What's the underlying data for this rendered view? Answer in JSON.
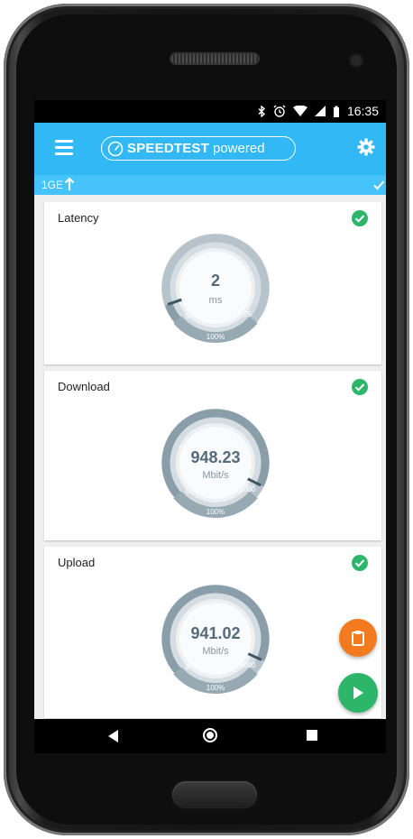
{
  "status_bar": {
    "time": "16:35",
    "icons": [
      "bluetooth-icon",
      "alarm-icon",
      "wifi-icon",
      "signal-icon",
      "battery-icon"
    ]
  },
  "app_bar": {
    "brand_main": "SPEEDTEST",
    "brand_sub": "powered",
    "menu_icon": "hamburger-menu-icon",
    "settings_icon": "gear-icon",
    "color": "#31b8f5"
  },
  "info_bar": {
    "label": "1GE",
    "arrow_icon": "arrow-up-icon",
    "check_icon": "checkmark-icon",
    "color": "#46c3fa"
  },
  "cards": [
    {
      "title": "Latency",
      "value": "2",
      "unit": "ms",
      "scale_min": "0",
      "scale_max": "25",
      "percent_label": "100%",
      "fraction": 0.08
    },
    {
      "title": "Download",
      "value": "948.23",
      "unit": "Mbit/s",
      "scale_min": "0",
      "scale_max": "1000",
      "percent_label": "100%",
      "fraction": 0.948
    },
    {
      "title": "Upload",
      "value": "941.02",
      "unit": "Mbit/s",
      "scale_min": "0",
      "scale_max": "1000",
      "percent_label": "100%",
      "fraction": 0.941
    }
  ],
  "fabs": {
    "clipboard_icon": "clipboard-icon",
    "clipboard_color": "#f47a1f",
    "play_icon": "play-icon",
    "play_color": "#2db669"
  },
  "nav_bar": {
    "back_icon": "back-triangle-icon",
    "home_icon": "home-circle-icon",
    "recent_icon": "recent-apps-square-icon"
  },
  "success_color": "#2db669"
}
